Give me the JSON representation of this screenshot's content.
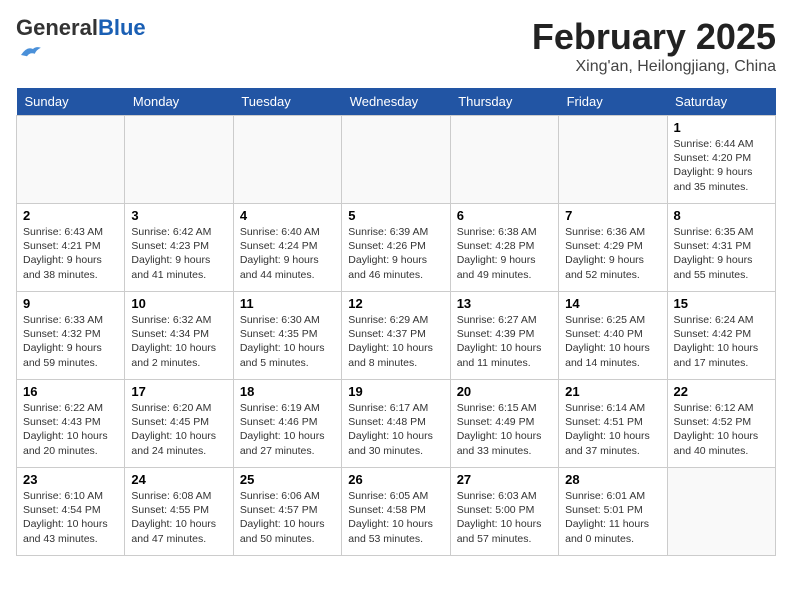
{
  "header": {
    "logo_general": "General",
    "logo_blue": "Blue",
    "month_year": "February 2025",
    "location": "Xing'an, Heilongjiang, China"
  },
  "weekdays": [
    "Sunday",
    "Monday",
    "Tuesday",
    "Wednesday",
    "Thursday",
    "Friday",
    "Saturday"
  ],
  "weeks": [
    [
      {
        "day": "",
        "info": ""
      },
      {
        "day": "",
        "info": ""
      },
      {
        "day": "",
        "info": ""
      },
      {
        "day": "",
        "info": ""
      },
      {
        "day": "",
        "info": ""
      },
      {
        "day": "",
        "info": ""
      },
      {
        "day": "1",
        "info": "Sunrise: 6:44 AM\nSunset: 4:20 PM\nDaylight: 9 hours and 35 minutes."
      }
    ],
    [
      {
        "day": "2",
        "info": "Sunrise: 6:43 AM\nSunset: 4:21 PM\nDaylight: 9 hours and 38 minutes."
      },
      {
        "day": "3",
        "info": "Sunrise: 6:42 AM\nSunset: 4:23 PM\nDaylight: 9 hours and 41 minutes."
      },
      {
        "day": "4",
        "info": "Sunrise: 6:40 AM\nSunset: 4:24 PM\nDaylight: 9 hours and 44 minutes."
      },
      {
        "day": "5",
        "info": "Sunrise: 6:39 AM\nSunset: 4:26 PM\nDaylight: 9 hours and 46 minutes."
      },
      {
        "day": "6",
        "info": "Sunrise: 6:38 AM\nSunset: 4:28 PM\nDaylight: 9 hours and 49 minutes."
      },
      {
        "day": "7",
        "info": "Sunrise: 6:36 AM\nSunset: 4:29 PM\nDaylight: 9 hours and 52 minutes."
      },
      {
        "day": "8",
        "info": "Sunrise: 6:35 AM\nSunset: 4:31 PM\nDaylight: 9 hours and 55 minutes."
      }
    ],
    [
      {
        "day": "9",
        "info": "Sunrise: 6:33 AM\nSunset: 4:32 PM\nDaylight: 9 hours and 59 minutes."
      },
      {
        "day": "10",
        "info": "Sunrise: 6:32 AM\nSunset: 4:34 PM\nDaylight: 10 hours and 2 minutes."
      },
      {
        "day": "11",
        "info": "Sunrise: 6:30 AM\nSunset: 4:35 PM\nDaylight: 10 hours and 5 minutes."
      },
      {
        "day": "12",
        "info": "Sunrise: 6:29 AM\nSunset: 4:37 PM\nDaylight: 10 hours and 8 minutes."
      },
      {
        "day": "13",
        "info": "Sunrise: 6:27 AM\nSunset: 4:39 PM\nDaylight: 10 hours and 11 minutes."
      },
      {
        "day": "14",
        "info": "Sunrise: 6:25 AM\nSunset: 4:40 PM\nDaylight: 10 hours and 14 minutes."
      },
      {
        "day": "15",
        "info": "Sunrise: 6:24 AM\nSunset: 4:42 PM\nDaylight: 10 hours and 17 minutes."
      }
    ],
    [
      {
        "day": "16",
        "info": "Sunrise: 6:22 AM\nSunset: 4:43 PM\nDaylight: 10 hours and 20 minutes."
      },
      {
        "day": "17",
        "info": "Sunrise: 6:20 AM\nSunset: 4:45 PM\nDaylight: 10 hours and 24 minutes."
      },
      {
        "day": "18",
        "info": "Sunrise: 6:19 AM\nSunset: 4:46 PM\nDaylight: 10 hours and 27 minutes."
      },
      {
        "day": "19",
        "info": "Sunrise: 6:17 AM\nSunset: 4:48 PM\nDaylight: 10 hours and 30 minutes."
      },
      {
        "day": "20",
        "info": "Sunrise: 6:15 AM\nSunset: 4:49 PM\nDaylight: 10 hours and 33 minutes."
      },
      {
        "day": "21",
        "info": "Sunrise: 6:14 AM\nSunset: 4:51 PM\nDaylight: 10 hours and 37 minutes."
      },
      {
        "day": "22",
        "info": "Sunrise: 6:12 AM\nSunset: 4:52 PM\nDaylight: 10 hours and 40 minutes."
      }
    ],
    [
      {
        "day": "23",
        "info": "Sunrise: 6:10 AM\nSunset: 4:54 PM\nDaylight: 10 hours and 43 minutes."
      },
      {
        "day": "24",
        "info": "Sunrise: 6:08 AM\nSunset: 4:55 PM\nDaylight: 10 hours and 47 minutes."
      },
      {
        "day": "25",
        "info": "Sunrise: 6:06 AM\nSunset: 4:57 PM\nDaylight: 10 hours and 50 minutes."
      },
      {
        "day": "26",
        "info": "Sunrise: 6:05 AM\nSunset: 4:58 PM\nDaylight: 10 hours and 53 minutes."
      },
      {
        "day": "27",
        "info": "Sunrise: 6:03 AM\nSunset: 5:00 PM\nDaylight: 10 hours and 57 minutes."
      },
      {
        "day": "28",
        "info": "Sunrise: 6:01 AM\nSunset: 5:01 PM\nDaylight: 11 hours and 0 minutes."
      },
      {
        "day": "",
        "info": ""
      }
    ]
  ]
}
